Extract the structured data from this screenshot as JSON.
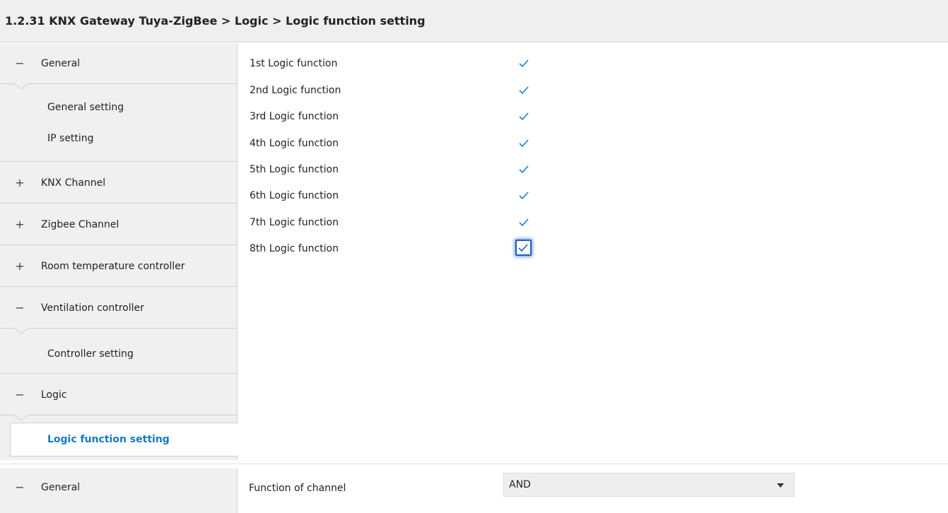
{
  "header": {
    "title": "1.2.31 KNX Gateway Tuya-ZigBee > Logic > Logic function setting"
  },
  "sidebar": {
    "items": [
      {
        "sign": "−",
        "label": "General"
      },
      {
        "label": "General setting"
      },
      {
        "label": "IP setting"
      },
      {
        "sign": "+",
        "label": "KNX Channel"
      },
      {
        "sign": "+",
        "label": "Zigbee Channel"
      },
      {
        "sign": "+",
        "label": "Room temperature controller"
      },
      {
        "sign": "−",
        "label": "Ventilation controller"
      },
      {
        "label": "Controller setting"
      },
      {
        "sign": "−",
        "label": "Logic"
      },
      {
        "label": "Logic function setting"
      }
    ]
  },
  "content": {
    "rows": [
      {
        "label": "1st Logic function",
        "checked": true
      },
      {
        "label": "2nd Logic function",
        "checked": true
      },
      {
        "label": "3rd Logic function",
        "checked": true
      },
      {
        "label": "4th Logic function",
        "checked": true
      },
      {
        "label": "5th Logic function",
        "checked": true
      },
      {
        "label": "6th Logic function",
        "checked": true
      },
      {
        "label": "7th Logic function",
        "checked": true
      },
      {
        "label": "8th Logic function",
        "checked": true
      }
    ],
    "check_color": "#1a7fd0"
  },
  "bottom": {
    "sidebar": {
      "sign": "−",
      "label": "General"
    },
    "field_label": "Function of channel",
    "select_value": "AND"
  }
}
